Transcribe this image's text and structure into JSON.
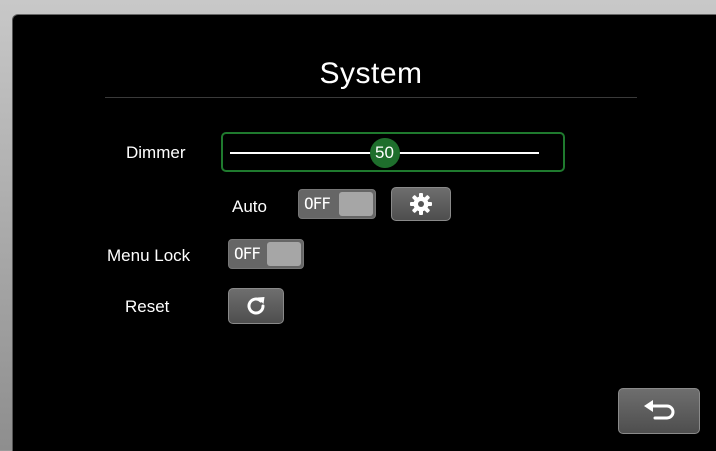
{
  "screen": {
    "title": "System"
  },
  "dimmer": {
    "label": "Dimmer",
    "value": 50,
    "value_label": "50",
    "min": 0,
    "max": 100,
    "accent_color": "#1e6e2c"
  },
  "auto": {
    "label": "Auto",
    "state_label": "OFF",
    "settings_icon": "gear-icon"
  },
  "menu_lock": {
    "label": "Menu Lock",
    "state_label": "OFF"
  },
  "reset": {
    "label": "Reset",
    "icon": "refresh-icon"
  },
  "back": {
    "icon": "back-arrow-icon"
  }
}
